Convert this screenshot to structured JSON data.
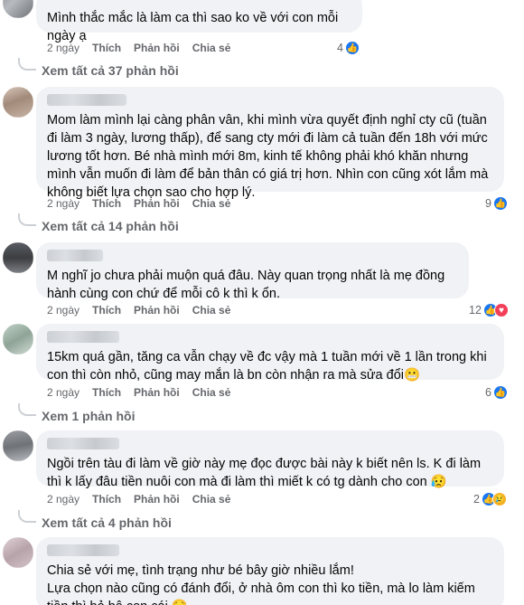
{
  "comments": [
    {
      "text": "Mình thắc mắc là làm ca thì sao ko về với con mỗi ngày ạ",
      "time": "2 ngày",
      "like": "Thích",
      "reply": "Phản hồi",
      "share": "Chia sẻ",
      "reaction_count": "4",
      "view_replies": "Xem tất cả 37 phản hồi"
    },
    {
      "text": "Mom làm mình lại càng phân vân, khi mình vừa quyết định nghỉ cty cũ (tuần đi làm 3 ngày, lương thấp), để sang cty mới đi làm cả tuần đến 18h với mức lương tốt hơn. Bé nhà mình mới 8m, kinh tế không phải khó khăn nhưng mình vẫn muốn đi làm để bản thân có giá trị hơn. Nhìn con cũng xót lắm mà không biết lựa chọn sao cho hợp lý.",
      "time": "2 ngày",
      "like": "Thích",
      "reply": "Phản hồi",
      "share": "Chia sẻ",
      "reaction_count": "9",
      "view_replies": "Xem tất cả 14 phản hồi"
    },
    {
      "text": "M nghĩ jo chưa phải muộn quá đâu. Này quan trọng nhất là mẹ đồng hành cùng con chứ để mỗi cô k thì k ổn.",
      "time": "2 ngày",
      "like": "Thích",
      "reply": "Phản hồi",
      "share": "Chia sẻ",
      "reaction_count": "12"
    },
    {
      "text": "15km quá gần, tăng ca vẫn chạy về đc vậy mà 1 tuần mới về 1 lần trong khi con thì còn nhỏ, cũng may mắn là bn còn nhận ra mà sửa đổi😬",
      "time": "2 ngày",
      "like": "Thích",
      "reply": "Phản hồi",
      "share": "Chia sẻ",
      "reaction_count": "6",
      "view_replies": "Xem 1 phản hồi"
    },
    {
      "text": "Ngồi trên tàu đi làm về giờ này mẹ đọc được bài này k biết nên ls. K đi làm thì k lấy đâu tiền nuôi con mà đi làm thì miết k có tg dành cho con 😥",
      "time": "2 ngày",
      "like": "Thích",
      "reply": "Phản hồi",
      "share": "Chia sẻ",
      "reaction_count": "2",
      "view_replies": "Xem tất cả 4 phản hồi"
    },
    {
      "text": "Chia sẻ với mẹ, tình trạng như bé bây giờ nhiều lắm!\nLựa chọn nào cũng có đánh đổi, ở nhà ôm con thì ko tiền, mà lo làm kiếm tiền thì bỏ bê con cái 😥"
    }
  ],
  "colors": {
    "bubble": "#f0f2f5",
    "meta_text": "#65676b",
    "like_blue": "#1877f2",
    "love_red": "#f33e58",
    "sad_yellow": "#f7b125"
  }
}
